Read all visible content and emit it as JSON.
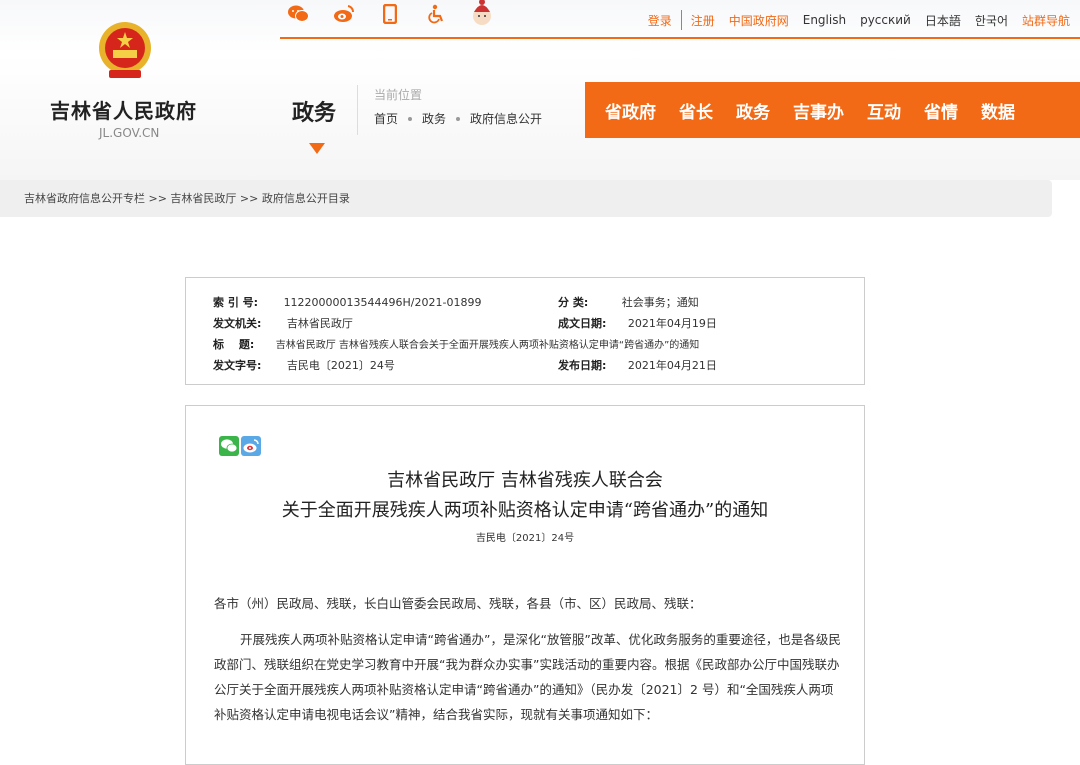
{
  "header": {
    "top_links": [
      "登录",
      "注册",
      "中国政府网",
      "English",
      "русский",
      "日本語",
      "한국어",
      "站群导航"
    ],
    "site_title": "吉林省人民政府",
    "site_url": "JL.GOV.CN",
    "section_title": "政务",
    "location_label": "当前位置",
    "location_path": [
      "首页",
      "政务",
      "政府信息公开"
    ],
    "nav_items": [
      "省政府",
      "省长",
      "政务",
      "吉事办",
      "互动",
      "省情",
      "数据"
    ],
    "icons": [
      "wechat-icon",
      "weibo-icon",
      "mobile-icon",
      "accessibility-icon",
      "mascot-icon"
    ],
    "accent_color": "#f26a15"
  },
  "breadcrumb": "吉林省政府信息公开专栏 >> 吉林省民政厅 >> 政府信息公开目录",
  "meta": {
    "index_label": "索 引 号:",
    "index_value": "11220000013544496H/2021-01899",
    "category_label": "分 类:",
    "category_value": "社会事务；通知",
    "issuer_label": "发文机关:",
    "issuer_value": "吉林省民政厅",
    "created_label": "成文日期:",
    "created_value": "2021年04月19日",
    "title_label": "标　 题:",
    "title_value": "吉林省民政厅 吉林省残疾人联合会关于全面开展残疾人两项补贴资格认定申请“跨省通办”的通知",
    "docno_label": "发文字号:",
    "docno_value": "吉民电〔2021〕24号",
    "published_label": "发布日期:",
    "published_value": "2021年04月21日"
  },
  "document": {
    "title_line1": "吉林省民政厅  吉林省残疾人联合会",
    "title_line2": "关于全面开展残疾人两项补贴资格认定申请“跨省通办”的通知",
    "doc_number": "吉民电〔2021〕24号",
    "salutation": "各市（州）民政局、残联，长白山管委会民政局、残联，各县（市、区）民政局、残联：",
    "paragraph1": "开展残疾人两项补贴资格认定申请“跨省通办”，是深化“放管服”改革、优化政务服务的重要途径，也是各级民政部门、残联组织在党史学习教育中开展“我为群众办实事”实践活动的重要内容。根据《民政部办公厅中国残联办公厅关于全面开展残疾人两项补贴资格认定申请“跨省通办”的通知》（民办发〔2021〕2 号）和“全国残疾人两项补贴资格认定申请电视电话会议”精神，结合我省实际，现就有关事项通知如下："
  }
}
